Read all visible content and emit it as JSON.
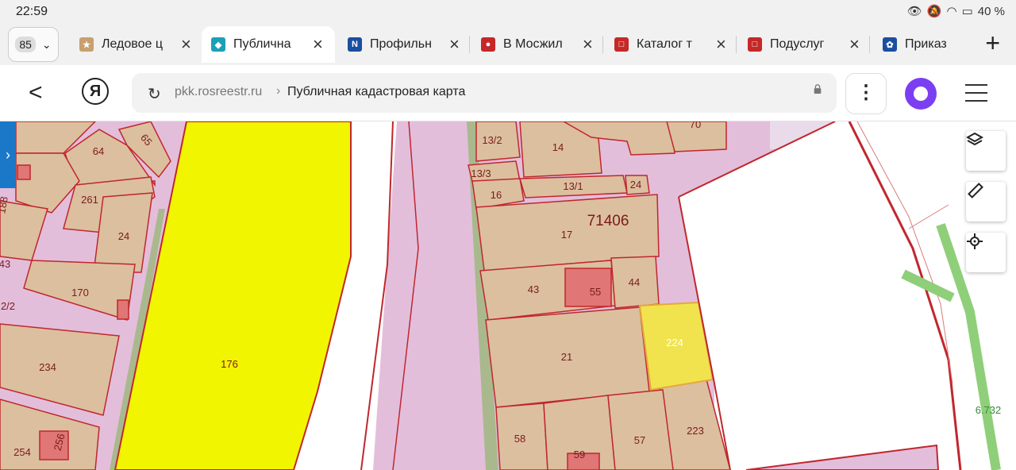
{
  "status": {
    "time": "22:59",
    "battery": "40 %"
  },
  "tabs": {
    "count": "85",
    "items": [
      {
        "title": "Ледовое ц",
        "fav_color": "#b08050",
        "fav_glyph": "★"
      },
      {
        "title": "Публична",
        "fav_color": "#1aa0b8",
        "fav_glyph": "◆"
      },
      {
        "title": "Профильн",
        "fav_color": "#1a4fa0",
        "fav_glyph": "N"
      },
      {
        "title": "В Мосжил",
        "fav_color": "#c62828",
        "fav_glyph": "●"
      },
      {
        "title": "Каталог т",
        "fav_color": "#c62828",
        "fav_glyph": "□"
      },
      {
        "title": "Подуслуг",
        "fav_color": "#c62828",
        "fav_glyph": "□"
      },
      {
        "title": "Приказ",
        "fav_color": "#1a4fa0",
        "fav_glyph": "✿"
      }
    ]
  },
  "address": {
    "domain": "pkk.rosreestr.ru",
    "page_title": "Публичная кадастровая карта"
  },
  "map": {
    "colors": {
      "parcel": "#dcbf9f",
      "zone": "#e3bedb",
      "border": "#c0272d",
      "highlight": "#f1e34d",
      "yellow": "#f2f500",
      "green": "#8fcf7a"
    },
    "labels": {
      "p64": "64",
      "p65": "65",
      "p261": "261",
      "p24a": "24",
      "p188": "188",
      "p170": "170",
      "p2_2": "2/2",
      "p43a": "43",
      "p234": "234",
      "p254": "254",
      "p256": "256",
      "p176": "176",
      "p13_2": "13/2",
      "p14": "14",
      "p70": "70",
      "p13_3": "13/3",
      "p16": "16",
      "p13_1": "13/1",
      "p24b": "24",
      "block": "71406",
      "p17": "17",
      "p43b": "43",
      "p55": "55",
      "p44": "44",
      "p21": "21",
      "p224": "224",
      "p58": "58",
      "p59": "59",
      "p57": "57",
      "p223": "223",
      "dist": "6.732"
    }
  }
}
